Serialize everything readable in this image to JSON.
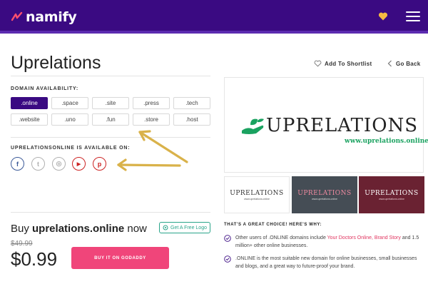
{
  "header": {
    "brand": "namify",
    "brand_color": "#3a0a82",
    "heart_icon": "heart-icon",
    "menu_icon": "hamburger-menu-icon"
  },
  "page": {
    "title": "Uprelations",
    "add_to_shortlist": "Add To Shortlist",
    "go_back": "Go Back"
  },
  "domain_availability": {
    "label": "DOMAIN AVAILABILITY:",
    "tlds": [
      ".online",
      ".space",
      ".site",
      ".press",
      ".tech",
      ".website",
      ".uno",
      ".fun",
      ".store",
      ".host"
    ],
    "selected": ".online"
  },
  "social": {
    "label": "UPRELATIONSONLINE IS AVAILABLE ON:",
    "networks": [
      {
        "name": "facebook",
        "glyph": "f",
        "color": "#3b5998"
      },
      {
        "name": "twitter",
        "glyph": "t",
        "color": "#b0b0b0"
      },
      {
        "name": "instagram",
        "glyph": "◎",
        "color": "#b0b0b0"
      },
      {
        "name": "youtube",
        "glyph": "▶",
        "color": "#cc2222"
      },
      {
        "name": "pinterest",
        "glyph": "p",
        "color": "#cc2222"
      }
    ]
  },
  "purchase": {
    "buy_prefix": "Buy ",
    "domain": "uprelations.online",
    "buy_suffix": " now",
    "get_logo": "Get A Free Logo",
    "old_price": "$49.99",
    "price": "$0.99",
    "cta": "BUY IT ON GODADDY",
    "cta_color": "#f0457a"
  },
  "logo_preview": {
    "wordmark": "UPRELATIONS",
    "url": "www.uprelations.online",
    "accent": "#1aa260",
    "thumbnails": [
      {
        "text": "UPRELATIONS",
        "sub": "www.uprelations.online",
        "bg": "#ffffff",
        "fg": "#333333"
      },
      {
        "text": "UPRELATIONS",
        "sub": "www.uprelations.online",
        "bg": "#454d55",
        "fg": "#f08aa0"
      },
      {
        "text": "UPRELATIONS",
        "sub": "www.uprelations.online",
        "bg": "#6a2232",
        "fg": "#ffffff"
      }
    ]
  },
  "why": {
    "heading": "THAT'S A GREAT CHOICE! HERE'S WHY:",
    "r1_pre": "Other users of .ONLINE domains include ",
    "r1_link": "Your Doctors Online, Brand Story",
    "r1_post": " and 1.5 million+ other online businesses.",
    "r2": ".ONLINE is the most suitable new domain for online businesses, small businesses and blogs, and a great way to future-proof your brand."
  }
}
